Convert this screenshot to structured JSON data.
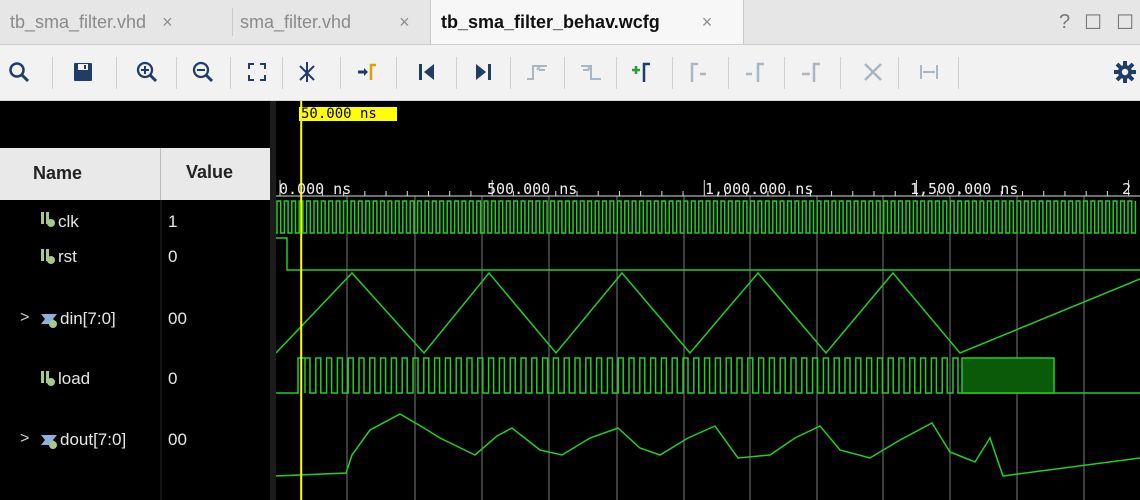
{
  "tabs": [
    {
      "label": "tb_sma_filter.vhd",
      "close": "×",
      "active": false
    },
    {
      "label": "sma_filter.vhd",
      "close": "×",
      "active": false
    },
    {
      "label": "tb_sma_filter_behav.wcfg",
      "close": "×",
      "active": true
    }
  ],
  "window_controls": {
    "help": "?",
    "restore": "☐",
    "extra": "☐"
  },
  "toolbar": {
    "icons": [
      "search-icon",
      "save-icon",
      "zoom-in-icon",
      "zoom-out-icon",
      "zoom-fit-icon",
      "cursor-disable-icon",
      "go-to-cursor-icon",
      "go-to-start-icon",
      "go-to-end-icon",
      "previous-transition-icon",
      "next-transition-icon",
      "add-marker-icon",
      "previous-marker-icon",
      "next-marker-icon",
      "delete-marker-icon",
      "delete-icon",
      "swap-cursors-icon",
      "settings-icon"
    ]
  },
  "columns": {
    "name": "Name",
    "value": "Value"
  },
  "signals": [
    {
      "name": "clk",
      "value": "1",
      "icon": "bit-signal-icon",
      "expandable": false
    },
    {
      "name": "rst",
      "value": "0",
      "icon": "bit-signal-icon",
      "expandable": false
    },
    {
      "name": "din[7:0]",
      "value": "00",
      "icon": "bus-signal-icon",
      "expandable": true,
      "caret": ">"
    },
    {
      "name": "load",
      "value": "0",
      "icon": "bit-signal-icon",
      "expandable": false
    },
    {
      "name": "dout[7:0]",
      "value": "00",
      "icon": "bus-signal-icon",
      "expandable": true,
      "caret": ">"
    }
  ],
  "cursor": {
    "label": "50.000 ns",
    "time_ns": 50
  },
  "ruler": {
    "labels": [
      "0.000 ns",
      "500.000 ns",
      "1,000.000 ns",
      "1,500.000 ns",
      "2"
    ],
    "tick_times_ns": [
      0,
      500,
      1000,
      1500,
      2000
    ]
  },
  "colors": {
    "wave": "#22d022",
    "cursor": "#ffff00",
    "background": "#000000",
    "grid": "#7a7a7a"
  }
}
